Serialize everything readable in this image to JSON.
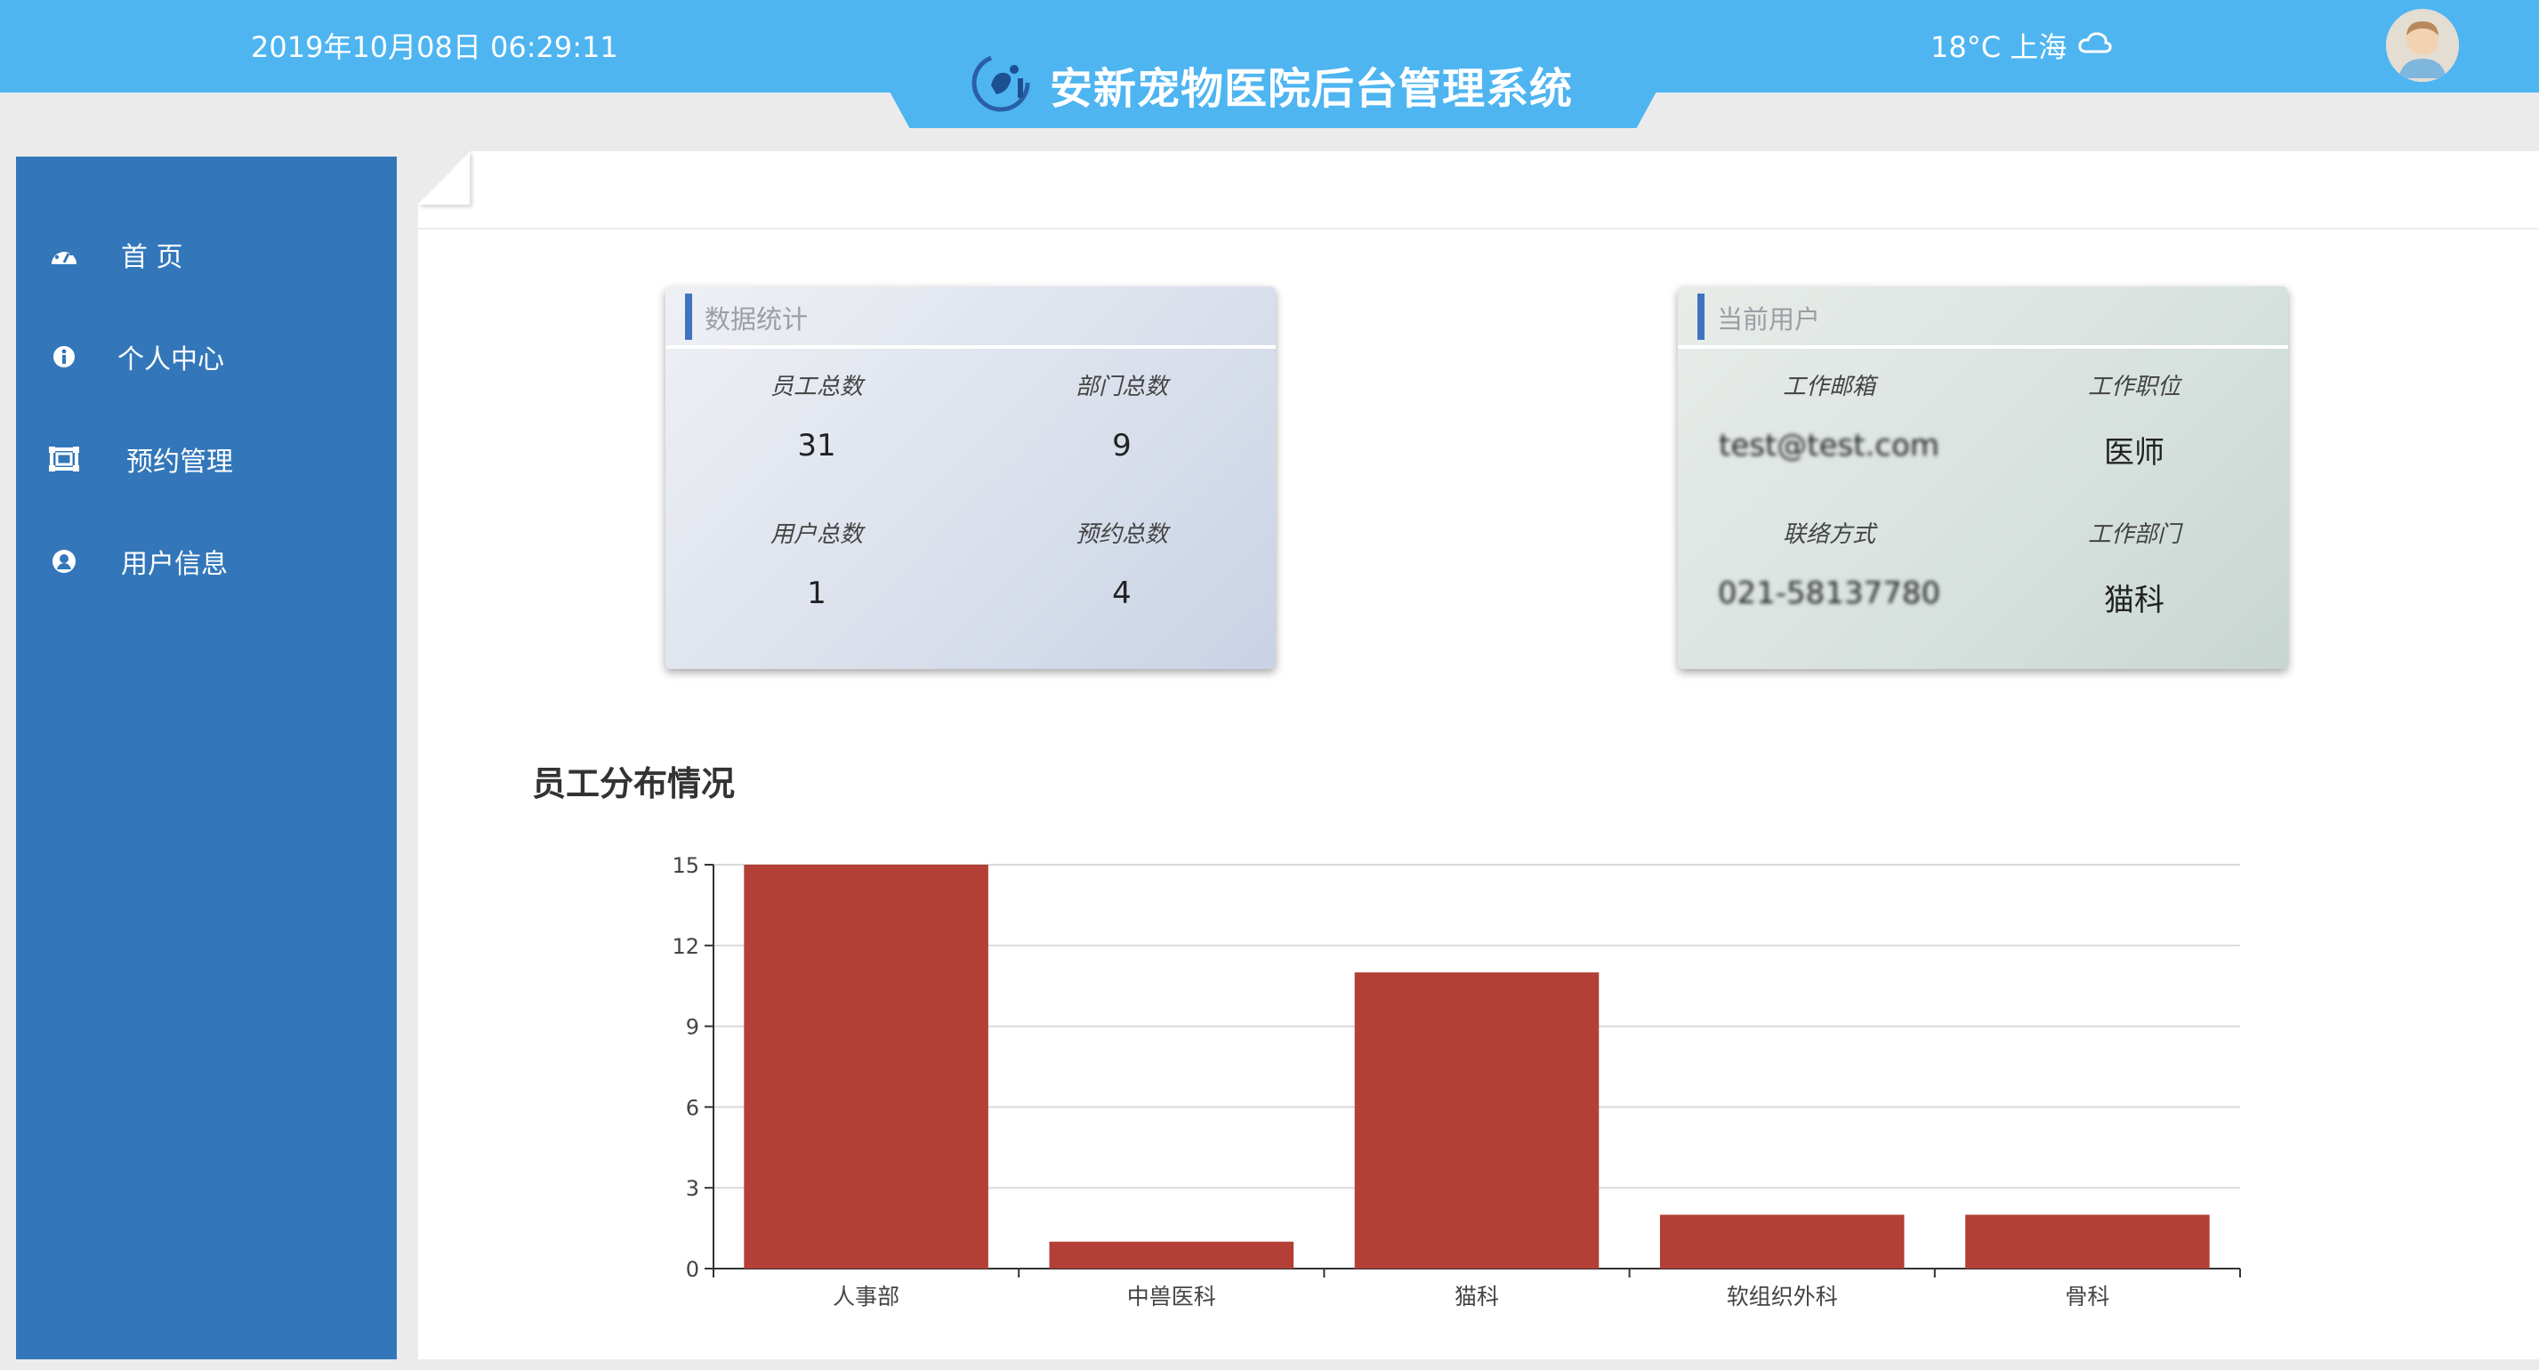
{
  "header": {
    "datetime": "2019年10月08日 06:29:11",
    "title": "安新宠物医院后台管理系统",
    "weather": "18°C 上海",
    "colors": {
      "bar": "#4eb5f1"
    }
  },
  "sidebar": {
    "items": [
      {
        "label": "首 页",
        "icon": "dashboard-icon"
      },
      {
        "label": "个人中心",
        "icon": "info-icon"
      },
      {
        "label": "预约管理",
        "icon": "frame-icon"
      },
      {
        "label": "用户信息",
        "icon": "user-circle-icon"
      }
    ]
  },
  "stats_card": {
    "title": "数据统计",
    "items": [
      {
        "label": "员工总数",
        "value": "31"
      },
      {
        "label": "部门总数",
        "value": "9"
      },
      {
        "label": "用户总数",
        "value": "1"
      },
      {
        "label": "预约总数",
        "value": "4"
      }
    ]
  },
  "user_card": {
    "title": "当前用户",
    "items": [
      {
        "label": "工作邮箱",
        "value": "test@test.com"
      },
      {
        "label": "工作职位",
        "value": "医师"
      },
      {
        "label": "联络方式",
        "value": "021-58137780"
      },
      {
        "label": "工作部门",
        "value": "猫科"
      }
    ]
  },
  "chart_section": {
    "title": "员工分布情况"
  },
  "chart_data": {
    "type": "bar",
    "categories": [
      "人事部",
      "中兽医科",
      "猫科",
      "软组织外科",
      "骨科"
    ],
    "values": [
      15,
      1,
      11,
      2,
      2
    ],
    "ylim": [
      0,
      15
    ],
    "yticks": [
      0,
      3,
      6,
      9,
      12,
      15
    ],
    "grid": true,
    "bar_color": "#b33f36"
  }
}
